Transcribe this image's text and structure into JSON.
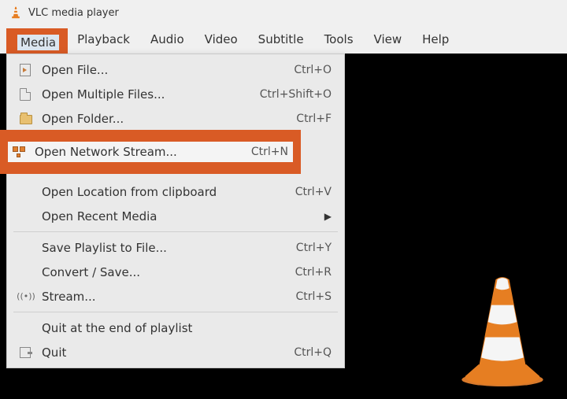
{
  "titlebar": {
    "title": "VLC media player"
  },
  "menubar": {
    "items": [
      "Media",
      "Playback",
      "Audio",
      "Video",
      "Subtitle",
      "Tools",
      "View",
      "Help"
    ],
    "active_index": 0
  },
  "dropdown": {
    "open_file": {
      "label": "Open File...",
      "shortcut": "Ctrl+O"
    },
    "open_multiple": {
      "label": "Open Multiple Files...",
      "shortcut": "Ctrl+Shift+O"
    },
    "open_folder": {
      "label": "Open Folder...",
      "shortcut": "Ctrl+F"
    },
    "open_network": {
      "label": "Open Network Stream...",
      "shortcut": "Ctrl+N"
    },
    "open_clipboard": {
      "label": "Open Location from clipboard",
      "shortcut": "Ctrl+V"
    },
    "open_recent": {
      "label": "Open Recent Media"
    },
    "save_playlist": {
      "label": "Save Playlist to File...",
      "shortcut": "Ctrl+Y"
    },
    "convert": {
      "label": "Convert / Save...",
      "shortcut": "Ctrl+R"
    },
    "stream": {
      "label": "Stream...",
      "shortcut": "Ctrl+S"
    },
    "quit_end": {
      "label": "Quit at the end of playlist"
    },
    "quit": {
      "label": "Quit",
      "shortcut": "Ctrl+Q"
    }
  },
  "highlight": {
    "color": "#d95b25",
    "menu_item": "Media",
    "dropdown_item": "Open Network Stream..."
  }
}
